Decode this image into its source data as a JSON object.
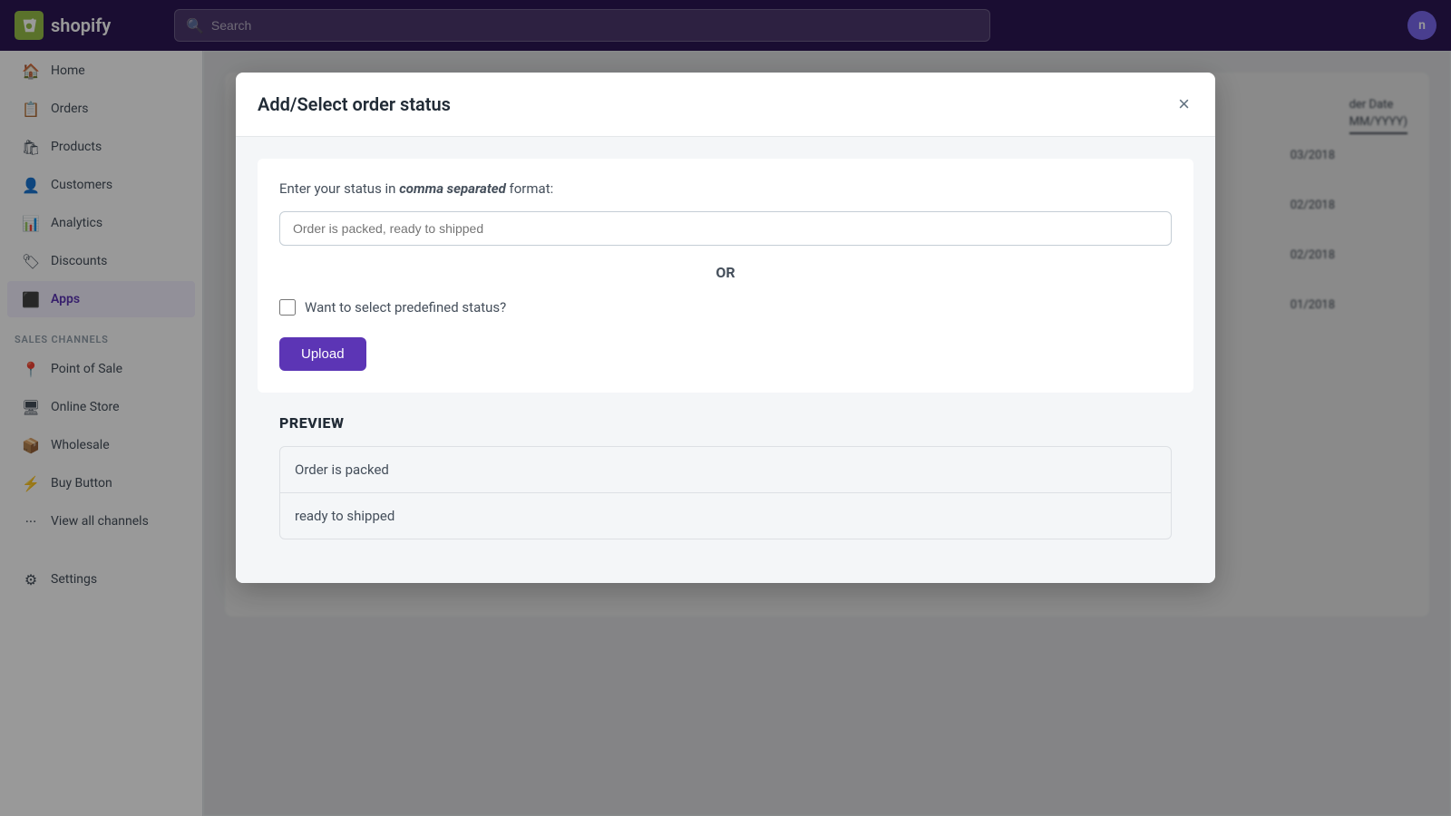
{
  "topbar": {
    "logo_text": "shopify",
    "search_placeholder": "Search"
  },
  "sidebar": {
    "nav_items": [
      {
        "id": "home",
        "label": "Home",
        "icon": "🏠"
      },
      {
        "id": "orders",
        "label": "Orders",
        "icon": "📋"
      },
      {
        "id": "products",
        "label": "Products",
        "icon": "🛍"
      },
      {
        "id": "customers",
        "label": "Customers",
        "icon": "👤"
      },
      {
        "id": "analytics",
        "label": "Analytics",
        "icon": "📊"
      },
      {
        "id": "discounts",
        "label": "Discounts",
        "icon": "🏷"
      },
      {
        "id": "apps",
        "label": "Apps",
        "icon": "🔷"
      }
    ],
    "sales_channels_label": "SALES CHANNELS",
    "sales_channels": [
      {
        "id": "point-of-sale",
        "label": "Point of Sale",
        "icon": "📍"
      },
      {
        "id": "online-store",
        "label": "Online Store",
        "icon": "🖥"
      },
      {
        "id": "wholesale",
        "label": "Wholesale",
        "icon": "📦"
      },
      {
        "id": "buy-button",
        "label": "Buy Button",
        "icon": "⚙"
      },
      {
        "id": "view-all",
        "label": "View all channels",
        "icon": "···"
      }
    ],
    "settings_label": "Settings"
  },
  "modal": {
    "title": "Add/Select order status",
    "close_label": "×",
    "instruction_prefix": "Enter your status in ",
    "instruction_bold": "comma separated",
    "instruction_suffix": " format:",
    "input_placeholder": "Order is packed, ready to shipped",
    "or_label": "OR",
    "checkbox_label": "Want to select predefined status?",
    "upload_button_label": "Upload",
    "preview_title": "PREVIEW",
    "preview_items": [
      {
        "text": "Order is packed"
      },
      {
        "text": "ready to shipped"
      }
    ]
  },
  "background": {
    "col_order_date": "der Date",
    "col_order_date_format": "MM/YYYY)",
    "dates": [
      "03/2018",
      "02/2018",
      "02/2018",
      "01/2018"
    ]
  }
}
